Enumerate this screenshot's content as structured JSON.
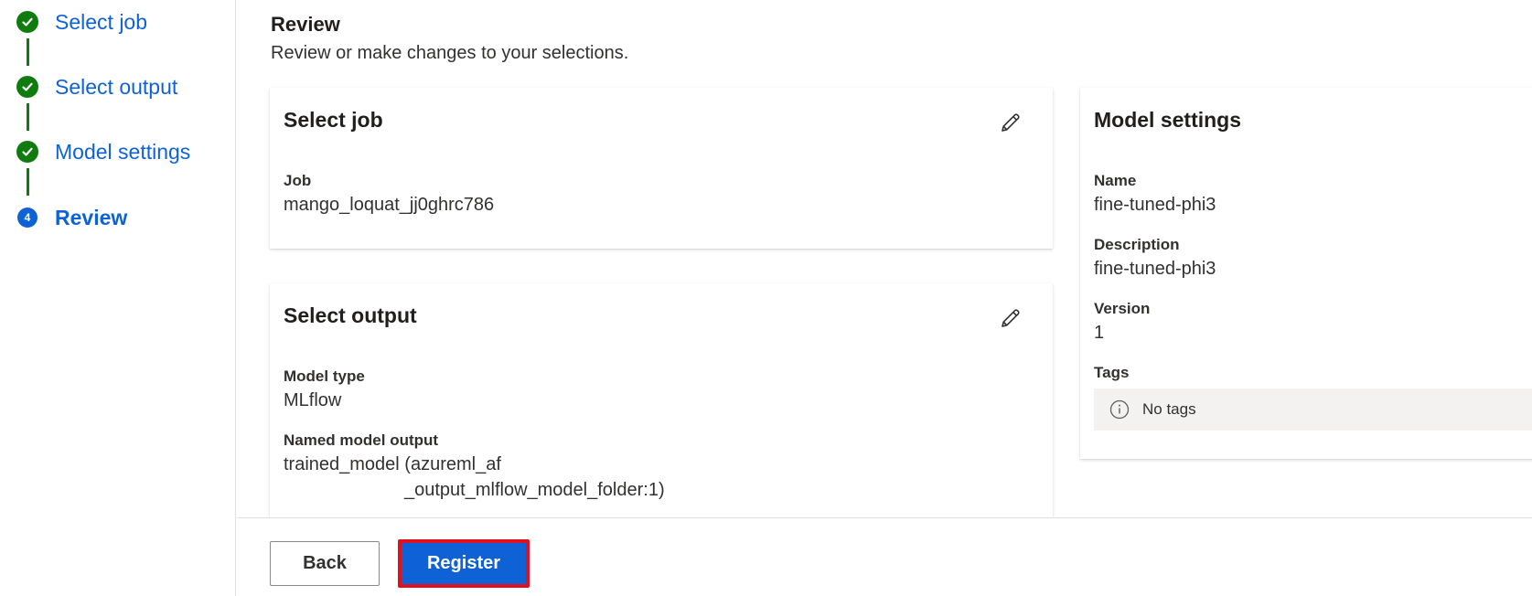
{
  "stepper": {
    "steps": [
      {
        "label": "Select job",
        "status": "done"
      },
      {
        "label": "Select output",
        "status": "done"
      },
      {
        "label": "Model settings",
        "status": "done"
      },
      {
        "label": "Review",
        "status": "current",
        "number": "4"
      }
    ]
  },
  "header": {
    "title": "Review",
    "subtitle": "Review or make changes to your selections."
  },
  "cards": {
    "select_job": {
      "title": "Select job",
      "fields": [
        {
          "label": "Job",
          "value": "mango_loquat_jj0ghrc786"
        }
      ]
    },
    "select_output": {
      "title": "Select output",
      "fields": [
        {
          "label": "Model type",
          "value": "MLflow"
        },
        {
          "label": "Named model output",
          "value_line1": "trained_model (azureml_af",
          "value_line2": "_output_mlflow_model_folder:1)"
        }
      ]
    },
    "model_settings": {
      "title": "Model settings",
      "fields": [
        {
          "label": "Name",
          "value": "fine-tuned-phi3"
        },
        {
          "label": "Description",
          "value": "fine-tuned-phi3"
        },
        {
          "label": "Version",
          "value": "1"
        },
        {
          "label": "Tags",
          "value": "No tags"
        }
      ]
    }
  },
  "footer": {
    "back_label": "Back",
    "register_label": "Register"
  },
  "colors": {
    "accent": "#0f62d6",
    "success": "#107c10",
    "highlight_border": "#e0101e"
  },
  "icons": {
    "step_done": "checkmark-circle-icon",
    "edit": "pencil-icon",
    "info": "info-icon"
  }
}
